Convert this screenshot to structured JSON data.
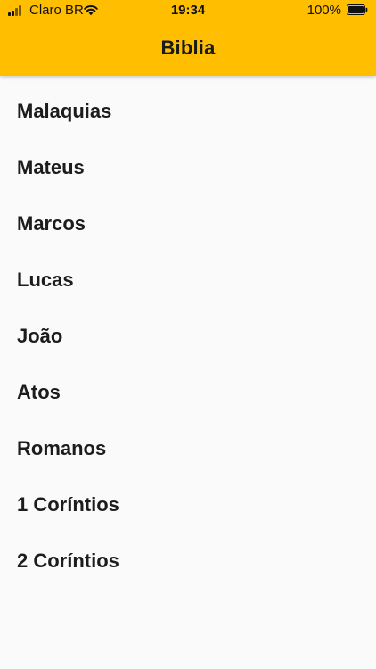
{
  "status_bar": {
    "carrier": "Claro BR",
    "time": "19:34",
    "battery_percent": "100%",
    "battery_level": 1.0,
    "signal_icon": "signal-bars-icon",
    "wifi_icon": "wifi-icon",
    "battery_icon": "battery-icon"
  },
  "header": {
    "title": "Biblia",
    "background_color": "#ffbf00"
  },
  "books": [
    {
      "label": "Malaquias"
    },
    {
      "label": "Mateus"
    },
    {
      "label": "Marcos"
    },
    {
      "label": "Lucas"
    },
    {
      "label": "João"
    },
    {
      "label": "Atos"
    },
    {
      "label": "Romanos"
    },
    {
      "label": "1 Coríntios"
    },
    {
      "label": "2 Coríntios"
    }
  ]
}
